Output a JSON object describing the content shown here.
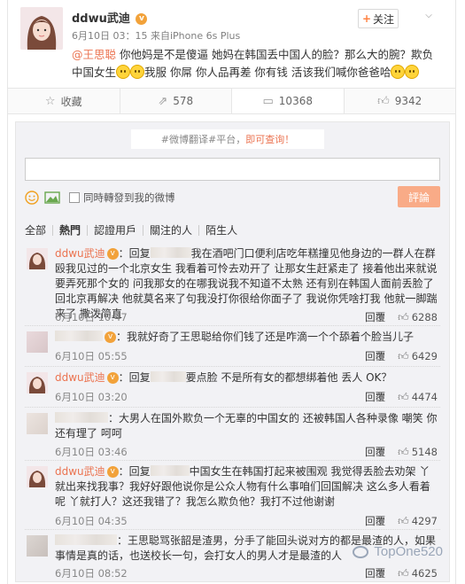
{
  "post": {
    "username": "ddwu武迪",
    "follow_label": "关注",
    "meta": "6月10日 03：15 来自iPhone 6s Plus",
    "text_parts": [
      "@王思聪",
      " 你他妈是不是傻逼 她妈在韩国丢中国人的脸？那么大的腕？欺负中国女生",
      "我服 你屌 你人品再差 你有钱 活该我们喊你爸爸哈"
    ]
  },
  "actions": {
    "collect": "收藏",
    "share": "578",
    "comment": "10368",
    "like": "9342"
  },
  "panel": {
    "topic_prefix": "#微博翻译#平台，",
    "topic_link": "即可查询！",
    "sync_label": "同時轉發到我的微博",
    "submit_label": "評論",
    "filters": [
      "全部",
      "熱門",
      "認證用戶",
      "關注的人",
      "陌生人"
    ]
  },
  "comments": [
    {
      "name": "ddwu武迪",
      "text_a": "：回复",
      "text_b": "我在酒吧门口便利店吃年糕撞见他身边的一群人在群殴我见过的一个北京女生 我看着可怜去劝开了 让那女生赶紧走了 接着他出来就说要弄死那个女的 问我那女的在哪我说我不知道不太熟 还有别在韩国人面前丢脸了 回北京再解决 他就莫名来了句我没打你很给你面子了 我说你凭啥打我 他就一脚踹来了 撒泼简直",
      "time": "6月10日 10:47",
      "reply": "回覆",
      "likes": "6288"
    },
    {
      "name": "",
      "text_a": "：我就好奇了王思聪给你们钱了还是咋滴一个个舔着个脸当儿子",
      "text_b": "",
      "time": "6月10日 05:55",
      "reply": "回覆",
      "likes": "6429"
    },
    {
      "name": "ddwu武迪",
      "text_a": "：回复",
      "text_b": "要点脸 不是所有女的都想绑着他 丢人 OK？",
      "time": "6月10日 03:20",
      "reply": "回覆",
      "likes": "4474"
    },
    {
      "name": "",
      "text_a": "：大男人在国外欺负一个无辜的中国女的 还被韩国人各种录像 嘲笑 你还有理了 呵呵",
      "text_b": "",
      "time": "6月10日 03:46",
      "reply": "回覆",
      "likes": "5148"
    },
    {
      "name": "ddwu武迪",
      "text_a": "：回复",
      "text_b": "中国女生在韩国打起来被围观 我觉得丢脸去劝架 丫就出来找我事？我好好跟他说你是公众人物有什么事咱们回国解决 这么多人看着呢 丫就打人？这还我错了？我怎么欺负他？我打不过他谢谢",
      "time": "6月10日 04:35",
      "reply": "回覆",
      "likes": "4297"
    },
    {
      "name": "",
      "text_a": "：王思聪骂张韶是渣男，分手了能回头说对方的都是最渣的人，如果事情是真的话，也送校长一句，会打女人的男人才是最渣的人",
      "text_b": "",
      "time": "6月10日 08:52",
      "reply": "回覆",
      "likes": "4625"
    }
  ],
  "watermark": "TopOne520"
}
